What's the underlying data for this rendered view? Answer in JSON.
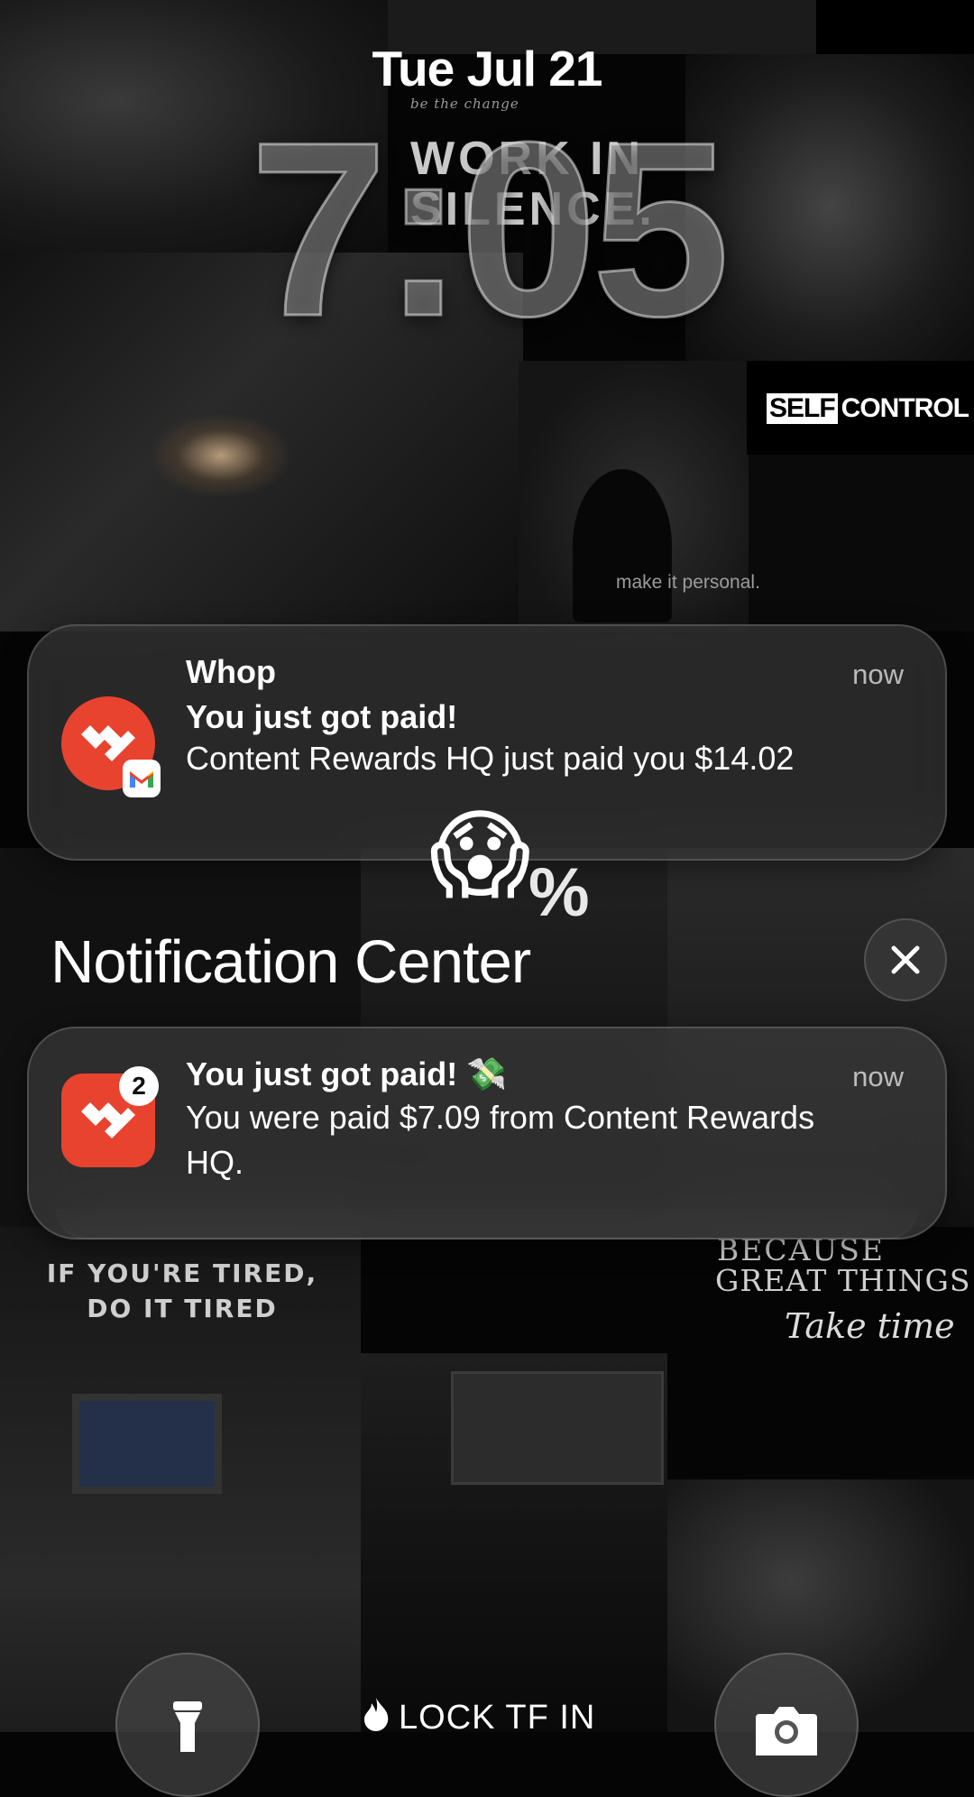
{
  "lock_screen": {
    "date": "Tue Jul 21",
    "time": "7:05"
  },
  "wallpaper_text": {
    "be_the_change": "be the change",
    "work_in_silence_line1": "WORK IN",
    "work_in_silence_line2": "SILENCE.",
    "self": "SELF",
    "control": "CONTROL",
    "make_it_personal": "make it personal.",
    "percent": "%",
    "tired_line1": "IF YOU'RE TIRED,",
    "tired_line2": "DO IT TIRED",
    "because": "BECAUSE",
    "great_things": "GREAT THINGS",
    "take_time": "Take time"
  },
  "notification_1": {
    "app": "Whop",
    "time": "now",
    "title": "You just got paid!",
    "body": "Content Rewards HQ just paid you $14.02",
    "icon": "whop-icon",
    "secondary_icon": "gmail-icon"
  },
  "overlay_emoji": "😱",
  "notification_center": {
    "title": "Notification Center",
    "close_icon": "close-icon"
  },
  "notification_2": {
    "time": "now",
    "title": "You just got paid! 💸",
    "body": "You were paid $7.09 from Content Rewards HQ.",
    "badge_count": "2",
    "icon": "whop-icon"
  },
  "bottom_bar": {
    "left_icon": "flashlight-icon",
    "center_text": "LOCK TF IN",
    "center_icon": "flame-icon",
    "right_icon": "camera-icon"
  },
  "colors": {
    "whop_red": "#e8432f",
    "notification_bg": "rgba(70,70,70,0.55)"
  }
}
